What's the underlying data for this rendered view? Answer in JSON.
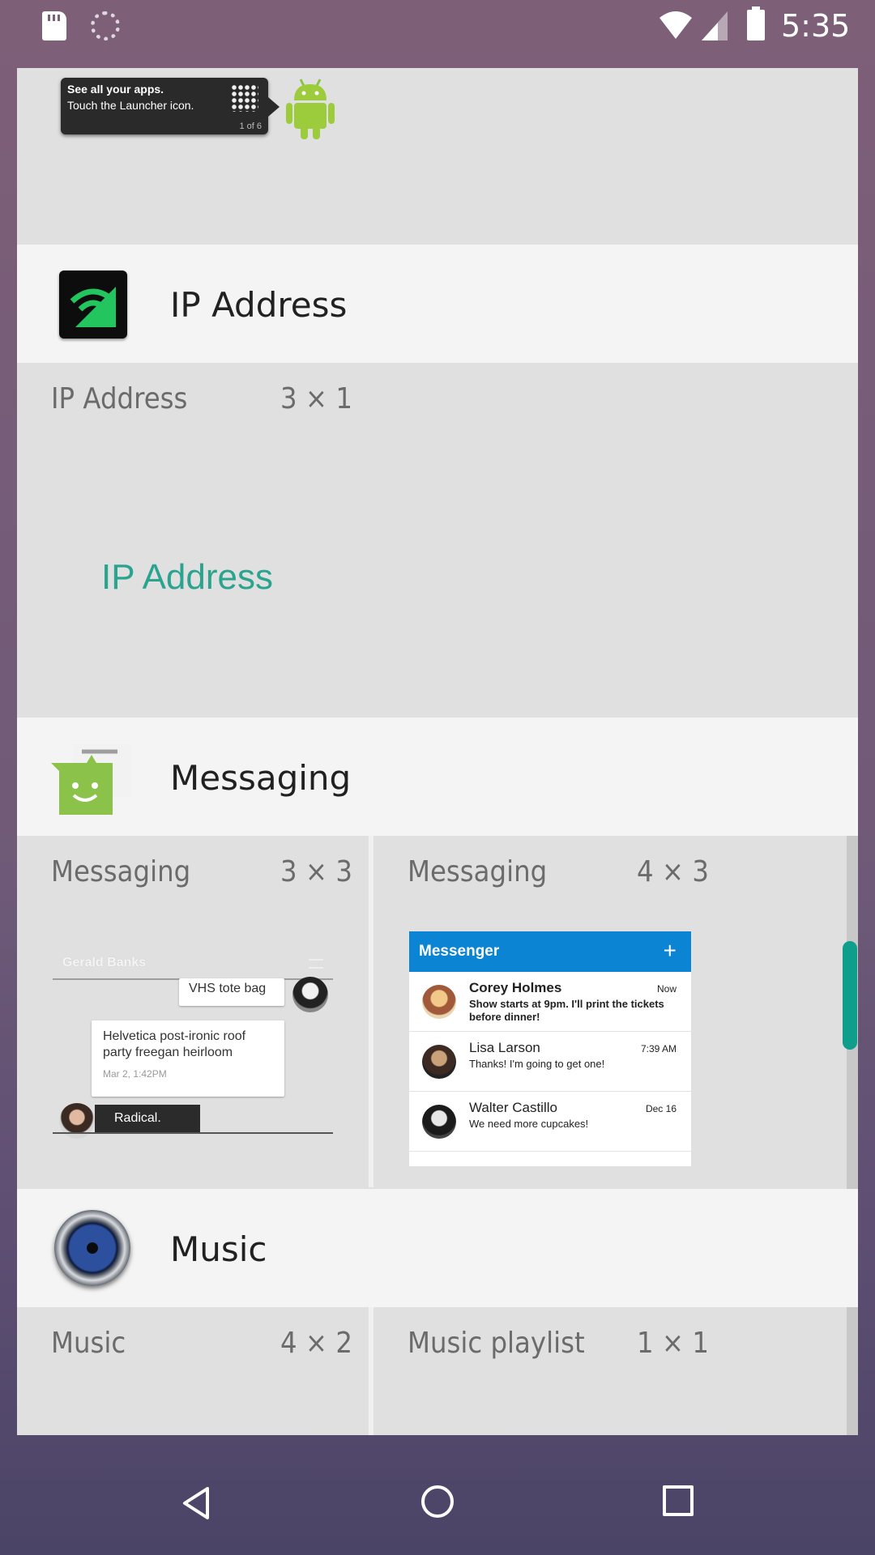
{
  "status_bar": {
    "time": "5:35",
    "icons": [
      "sd-card-icon",
      "sync-icon",
      "wifi-icon",
      "signal-icon",
      "battery-icon"
    ]
  },
  "launcher_hint": {
    "line1": "See all your apps.",
    "line2": "Touch the Launcher icon.",
    "counter": "1 of 6"
  },
  "apps": [
    {
      "title": "IP Address",
      "icon": "ip-address-icon",
      "widgets": [
        {
          "name": "IP Address",
          "size": "3 × 1",
          "preview_text": "IP Address"
        }
      ]
    },
    {
      "title": "Messaging",
      "icon": "messaging-icon",
      "widgets": [
        {
          "name": "Messaging",
          "size": "3 × 3",
          "preview": {
            "contact": "Gerald Banks",
            "bubble1": "VHS tote bag",
            "bubble2": "Helvetica post-ironic roof party freegan heirloom",
            "bubble2_time": "Mar 2, 1:42PM",
            "dark_bubble": "Radical."
          }
        },
        {
          "name": "Messaging",
          "size": "4 × 3",
          "preview": {
            "title": "Messenger",
            "plus": "+",
            "threads": [
              {
                "name": "Corey Holmes",
                "message": "Show starts at 9pm. I'll print the tickets before dinner!",
                "time": "Now"
              },
              {
                "name": "Lisa Larson",
                "message": "Thanks! I'm going to get one!",
                "time": "7:39 AM"
              },
              {
                "name": "Walter Castillo",
                "message": "We need more cupcakes!",
                "time": "Dec 16"
              }
            ]
          }
        }
      ]
    },
    {
      "title": "Music",
      "icon": "music-icon",
      "widgets": [
        {
          "name": "Music",
          "size": "4 × 2"
        },
        {
          "name": "Music playlist",
          "size": "1 × 1"
        }
      ]
    }
  ],
  "colors": {
    "accent": "#2aa38f",
    "scroll_thumb": "#0f9d8c",
    "messenger_header": "#0b84d4"
  }
}
